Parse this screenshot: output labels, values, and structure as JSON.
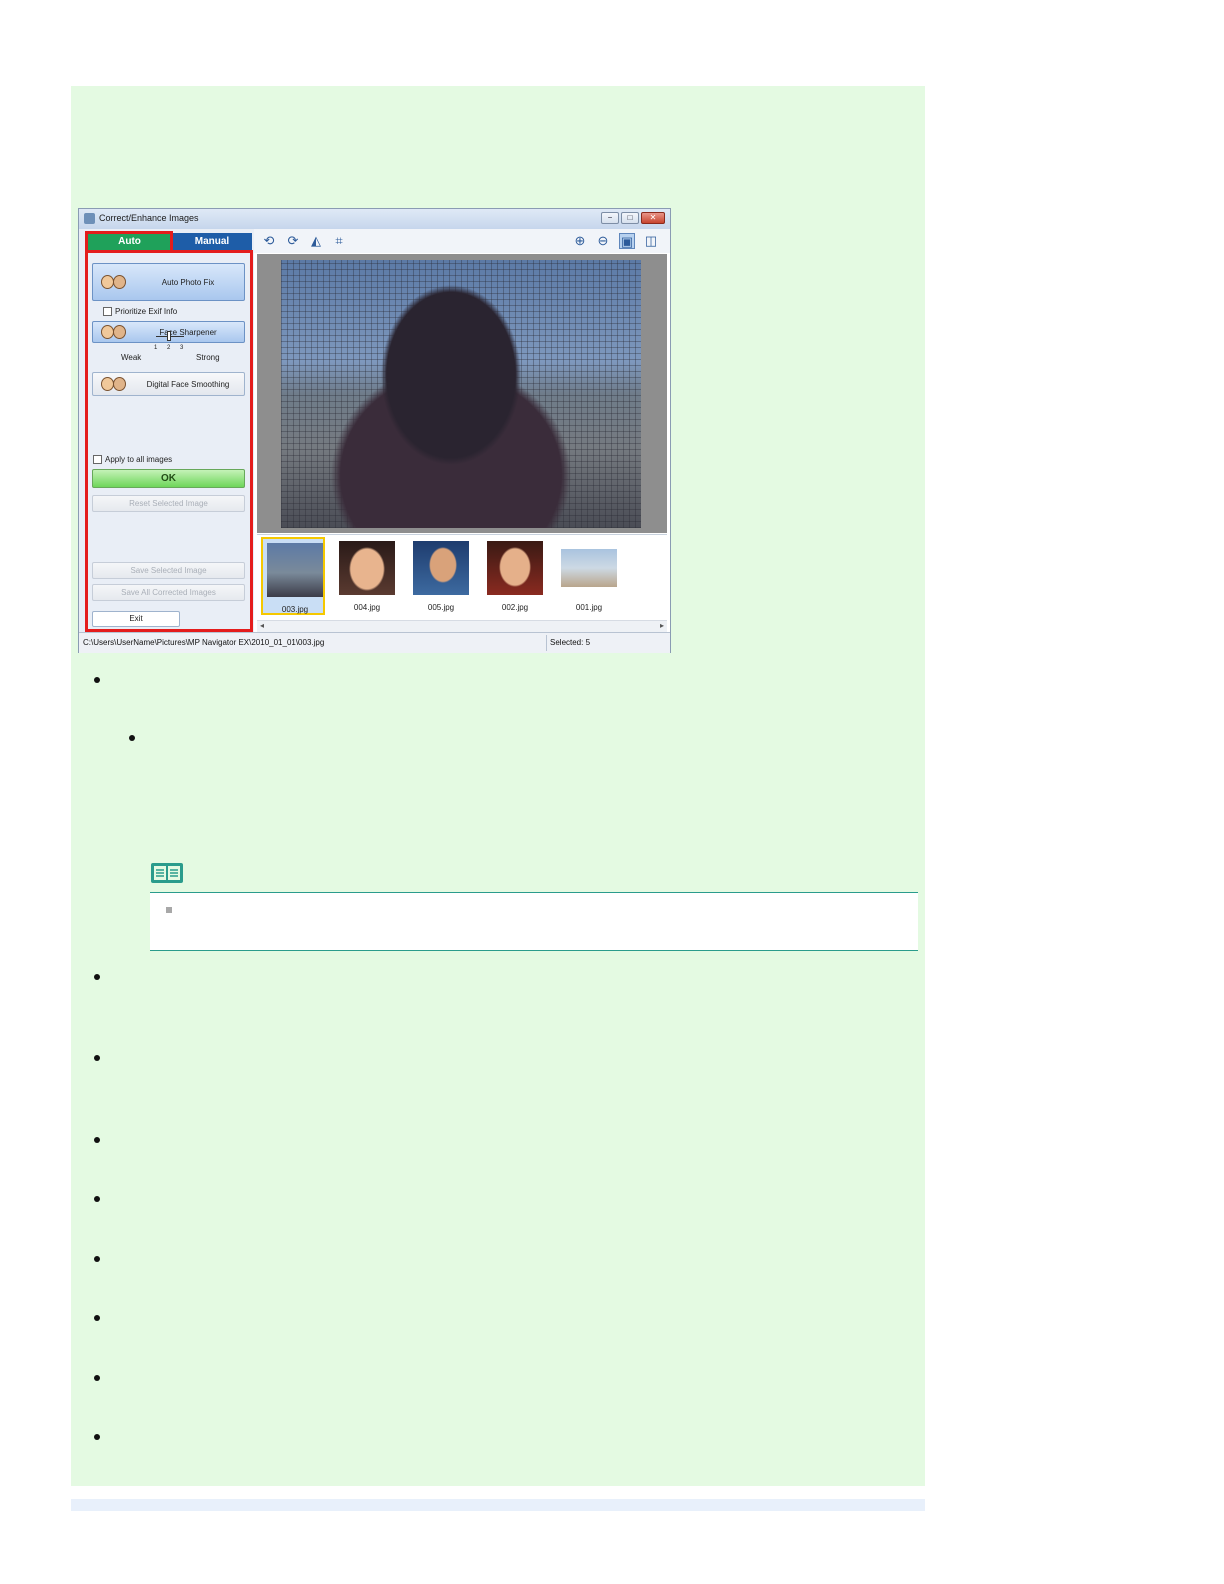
{
  "window": {
    "title": "Correct/Enhance Images",
    "controls": [
      "−",
      "□",
      "✕"
    ]
  },
  "tabs": {
    "auto": "Auto",
    "manual": "Manual"
  },
  "auto_panel": {
    "auto_photo_fix": "Auto Photo Fix",
    "prioritize_exif": "Prioritize Exif Info",
    "face_sharpener": "Face Sharpener",
    "slider": {
      "weak": "Weak",
      "strong": "Strong",
      "ticks": [
        "1",
        "2",
        "3"
      ],
      "value": 2
    },
    "digital_face_smoothing": "Digital Face Smoothing",
    "apply_all": "Apply to all images",
    "ok": "OK",
    "reset_selected": "Reset Selected Image",
    "save_selected": "Save Selected Image",
    "save_all": "Save All Corrected Images",
    "exit": "Exit"
  },
  "toolbar": {
    "icons": [
      "rotate-left-icon",
      "rotate-right-icon",
      "flip-icon",
      "crop-icon",
      "zoom-in-icon",
      "zoom-out-icon",
      "whole-image-view-icon",
      "compare-view-icon"
    ]
  },
  "thumbnails": [
    {
      "name": "003.jpg",
      "selected": true
    },
    {
      "name": "004.jpg",
      "selected": false
    },
    {
      "name": "005.jpg",
      "selected": false
    },
    {
      "name": "002.jpg",
      "selected": false
    },
    {
      "name": "001.jpg",
      "selected": false
    }
  ],
  "status": {
    "path": "C:\\Users\\UserName\\Pictures\\MP Navigator EX\\2010_01_01\\003.jpg",
    "selected": "Selected: 5"
  }
}
